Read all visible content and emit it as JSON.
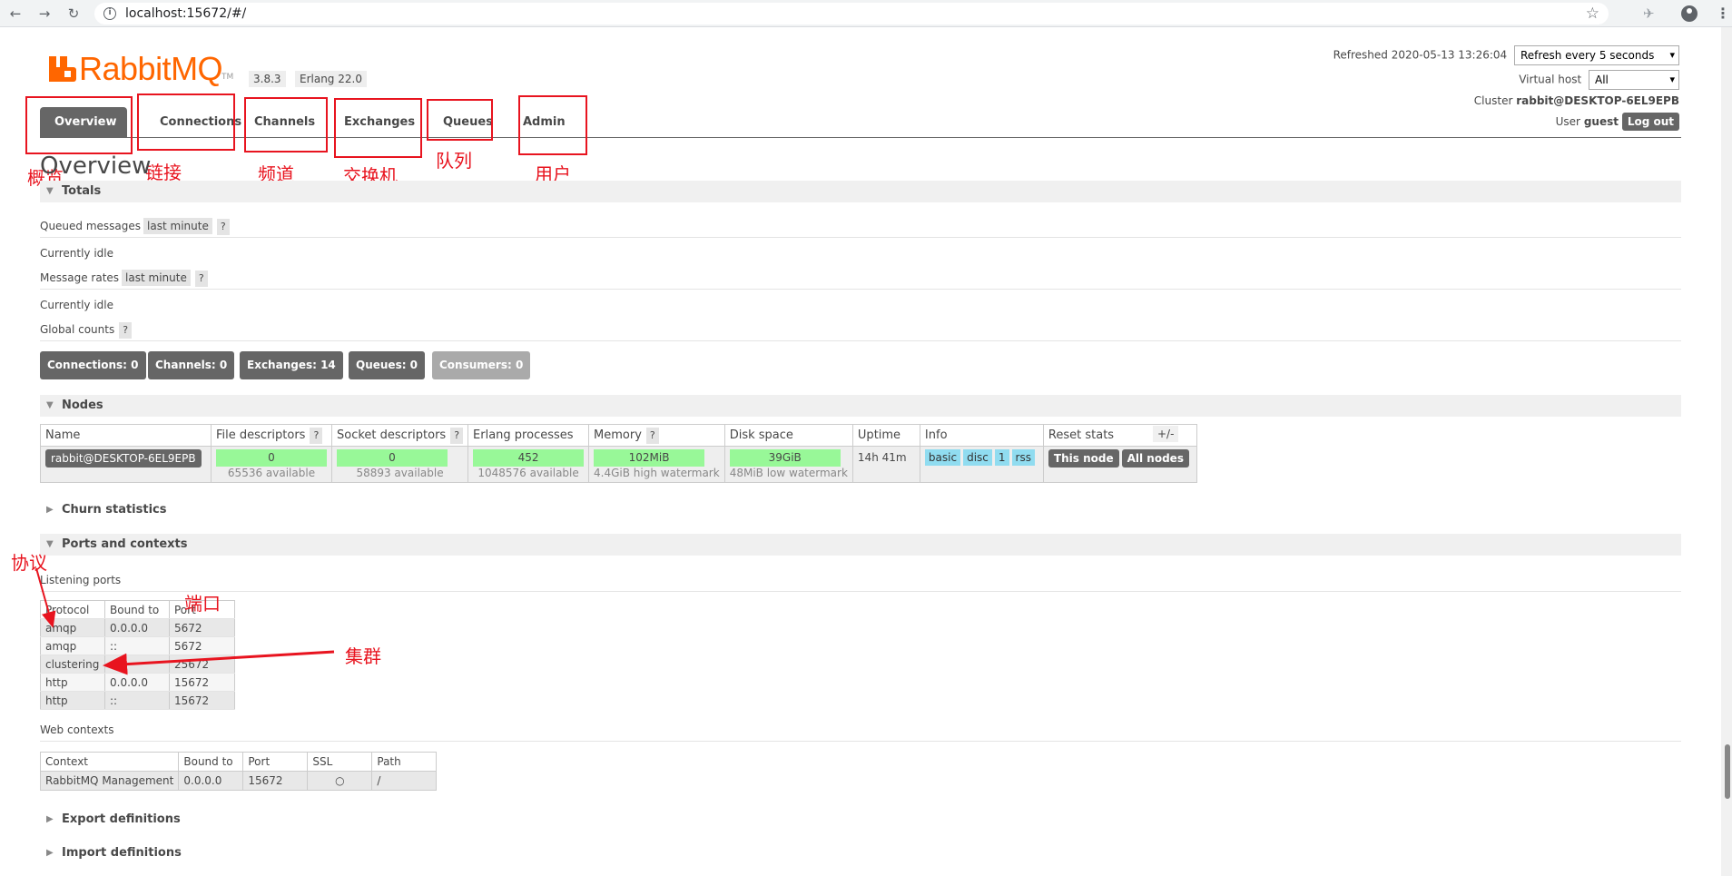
{
  "browser": {
    "url": "localhost:15672/#/"
  },
  "header": {
    "logo_text": "RabbitMQ",
    "logo_tm": "TM",
    "version": "3.8.3",
    "erlang": "Erlang 22.0",
    "refreshed_label": "Refreshed 2020-05-13 13:26:04",
    "refresh_select": "Refresh every 5 seconds",
    "vhost_label": "Virtual host",
    "vhost_select": "All",
    "cluster_label": "Cluster",
    "cluster_value": "rabbit@DESKTOP-6EL9EPB",
    "user_label": "User",
    "user_value": "guest",
    "logout": "Log out"
  },
  "tabs": [
    {
      "label": "Overview",
      "active": true
    },
    {
      "label": "Connections"
    },
    {
      "label": "Channels"
    },
    {
      "label": "Exchanges"
    },
    {
      "label": "Queues"
    },
    {
      "label": "Admin"
    }
  ],
  "annotations": {
    "overview": "概览",
    "connections": "链接",
    "channels": "频道",
    "exchanges": "交换机",
    "queues": "队列",
    "admin": "用户",
    "protocol": "协议",
    "port": "端口",
    "cluster": "集群"
  },
  "page_title": "Overview",
  "totals": {
    "section": "Totals",
    "queued_messages": "Queued messages",
    "last_minute": "last minute",
    "help": "?",
    "currently_idle_1": "Currently idle",
    "message_rates": "Message rates",
    "currently_idle_2": "Currently idle",
    "global_counts": "Global counts",
    "counts": [
      "Connections: 0",
      "Channels: 0",
      "Exchanges: 14",
      "Queues: 0",
      "Consumers: 0"
    ]
  },
  "nodes": {
    "section": "Nodes",
    "headers": [
      "Name",
      "File descriptors",
      "Socket descriptors",
      "Erlang processes",
      "Memory",
      "Disk space",
      "Uptime",
      "Info",
      "Reset stats"
    ],
    "plusminus": "+/-",
    "row": {
      "name": "rabbit@DESKTOP-6EL9EPB",
      "fd": "0",
      "fd_sub": "65536 available",
      "sd": "0",
      "sd_sub": "58893 available",
      "ep": "452",
      "ep_sub": "1048576 available",
      "mem": "102MiB",
      "mem_sub": "4.4GiB high watermark",
      "disk": "39GiB",
      "disk_sub": "48MiB low watermark",
      "uptime": "14h 41m",
      "info": [
        "basic",
        "disc",
        "1",
        "rss"
      ],
      "this_node": "This node",
      "all_nodes": "All nodes"
    }
  },
  "churn": {
    "section": "Churn statistics"
  },
  "ports": {
    "section": "Ports and contexts",
    "listening": "Listening ports",
    "headers": [
      "Protocol",
      "Bound to",
      "Port"
    ],
    "rows": [
      [
        "amqp",
        "0.0.0.0",
        "5672"
      ],
      [
        "amqp",
        "::",
        "5672"
      ],
      [
        "clustering",
        "::",
        "25672"
      ],
      [
        "http",
        "0.0.0.0",
        "15672"
      ],
      [
        "http",
        "::",
        "15672"
      ]
    ],
    "web_contexts": "Web contexts",
    "web_headers": [
      "Context",
      "Bound to",
      "Port",
      "SSL",
      "Path"
    ],
    "web_row": [
      "RabbitMQ Management",
      "0.0.0.0",
      "15672",
      "○",
      "/"
    ]
  },
  "export": {
    "section": "Export definitions"
  },
  "import": {
    "section": "Import definitions"
  },
  "colors": {
    "brand": "#ff6600",
    "annotation": "#e8141f",
    "bar_green": "#98f898",
    "info_blue": "#90dcf0"
  }
}
